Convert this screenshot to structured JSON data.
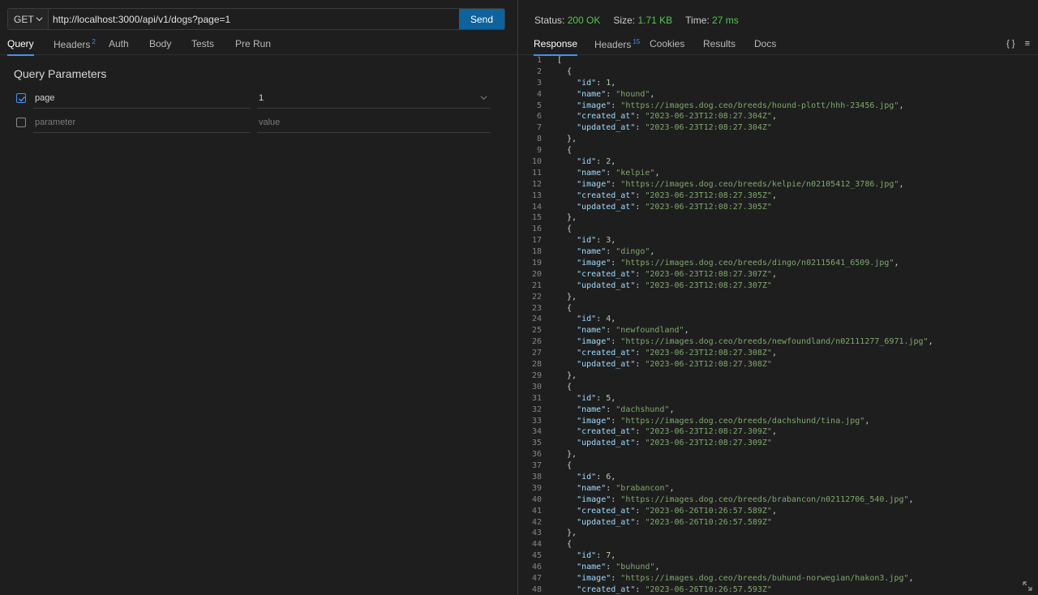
{
  "request": {
    "method": "GET",
    "url": "http://localhost:3000/api/v1/dogs?page=1",
    "send_label": "Send"
  },
  "request_tabs": [
    {
      "label": "Query",
      "badge": "",
      "active": true
    },
    {
      "label": "Headers",
      "badge": "2",
      "active": false
    },
    {
      "label": "Auth",
      "badge": "",
      "active": false
    },
    {
      "label": "Body",
      "badge": "",
      "active": false
    },
    {
      "label": "Tests",
      "badge": "",
      "active": false
    },
    {
      "label": "Pre Run",
      "badge": "",
      "active": false
    }
  ],
  "query": {
    "title": "Query Parameters",
    "rows": [
      {
        "checked": true,
        "key": "page",
        "value": "1"
      },
      {
        "checked": false,
        "key": "",
        "value": "",
        "key_placeholder": "parameter",
        "value_placeholder": "value"
      }
    ]
  },
  "status": {
    "status_label": "Status:",
    "status_value": "200 OK",
    "size_label": "Size:",
    "size_value": "1.71 KB",
    "time_label": "Time:",
    "time_value": "27 ms"
  },
  "response_tabs": [
    {
      "label": "Response",
      "badge": "",
      "active": true
    },
    {
      "label": "Headers",
      "badge": "15",
      "active": false
    },
    {
      "label": "Cookies",
      "badge": "",
      "active": false
    },
    {
      "label": "Results",
      "badge": "",
      "active": false
    },
    {
      "label": "Docs",
      "badge": "",
      "active": false
    }
  ],
  "response_icons": {
    "format": "{ }",
    "menu": "≡"
  },
  "colors": {
    "accent": "#3794ff",
    "send": "#0e639c",
    "status_ok": "#4ec94e"
  },
  "response_body": [
    {
      "id": 1,
      "name": "hound",
      "image": "https://images.dog.ceo/breeds/hound-plott/hhh-23456.jpg",
      "created_at": "2023-06-23T12:08:27.304Z",
      "updated_at": "2023-06-23T12:08:27.304Z"
    },
    {
      "id": 2,
      "name": "kelpie",
      "image": "https://images.dog.ceo/breeds/kelpie/n02105412_3786.jpg",
      "created_at": "2023-06-23T12:08:27.305Z",
      "updated_at": "2023-06-23T12:08:27.305Z"
    },
    {
      "id": 3,
      "name": "dingo",
      "image": "https://images.dog.ceo/breeds/dingo/n02115641_6509.jpg",
      "created_at": "2023-06-23T12:08:27.307Z",
      "updated_at": "2023-06-23T12:08:27.307Z"
    },
    {
      "id": 4,
      "name": "newfoundland",
      "image": "https://images.dog.ceo/breeds/newfoundland/n02111277_6971.jpg",
      "created_at": "2023-06-23T12:08:27.308Z",
      "updated_at": "2023-06-23T12:08:27.308Z"
    },
    {
      "id": 5,
      "name": "dachshund",
      "image": "https://images.dog.ceo/breeds/dachshund/tina.jpg",
      "created_at": "2023-06-23T12:08:27.309Z",
      "updated_at": "2023-06-23T12:08:27.309Z"
    },
    {
      "id": 6,
      "name": "brabancon",
      "image": "https://images.dog.ceo/breeds/brabancon/n02112706_540.jpg",
      "created_at": "2023-06-26T10:26:57.589Z",
      "updated_at": "2023-06-26T10:26:57.589Z"
    },
    {
      "id": 7,
      "name": "buhund",
      "image": "https://images.dog.ceo/breeds/buhund-norwegian/hakon3.jpg",
      "created_at": "2023-06-26T10:26:57.593Z"
    }
  ]
}
